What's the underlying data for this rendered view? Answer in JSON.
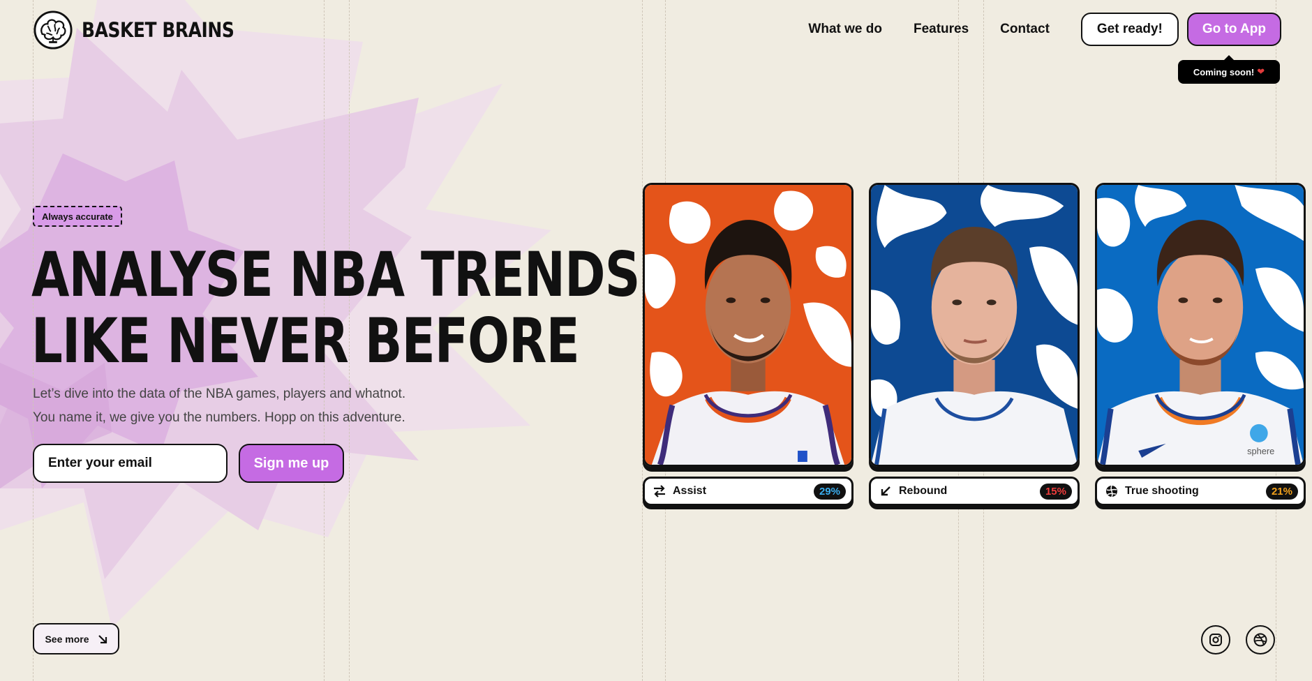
{
  "brand": {
    "name": "BASKET BRAINS"
  },
  "nav": {
    "links": [
      "What we do",
      "Features",
      "Contact"
    ],
    "get_ready": "Get ready!",
    "go_to_app": "Go to App",
    "tooltip": "Coming soon!"
  },
  "hero": {
    "badge": "Always accurate",
    "headline_line1": "ANALYSE NBA TRENDS",
    "headline_line2": "LIKE NEVER BEFORE",
    "sub_line1": "Let’s dive into the data of the NBA games, players and whatnot.",
    "sub_line2": "You name it, we give you the numbers. Hopp on this adventure.",
    "email_placeholder": "Enter your email",
    "signup": "Sign me up",
    "see_more": "See more"
  },
  "cards": [
    {
      "stat": "Assist",
      "value": "29%",
      "value_color": "#3aaef0",
      "icon": "swap-arrows-icon",
      "bg_color": "#e4541a",
      "jersey_trim": "#e4541a"
    },
    {
      "stat": "Rebound",
      "value": "15%",
      "value_color": "#ef3b3b",
      "icon": "arrow-down-left-icon",
      "bg_color": "#0d4a93",
      "jersey_trim": "#1d4ea0"
    },
    {
      "stat": "True shooting",
      "value": "21%",
      "value_color": "#f4a21c",
      "icon": "basketball-icon",
      "bg_color": "#0a6bc2",
      "jersey_trim": "#f07a24",
      "jersey_text": "sphere"
    }
  ],
  "colors": {
    "background": "#f0ece1",
    "accent": "#c56be3",
    "ink": "#111111"
  },
  "social": [
    "instagram-icon",
    "dribbble-icon"
  ]
}
